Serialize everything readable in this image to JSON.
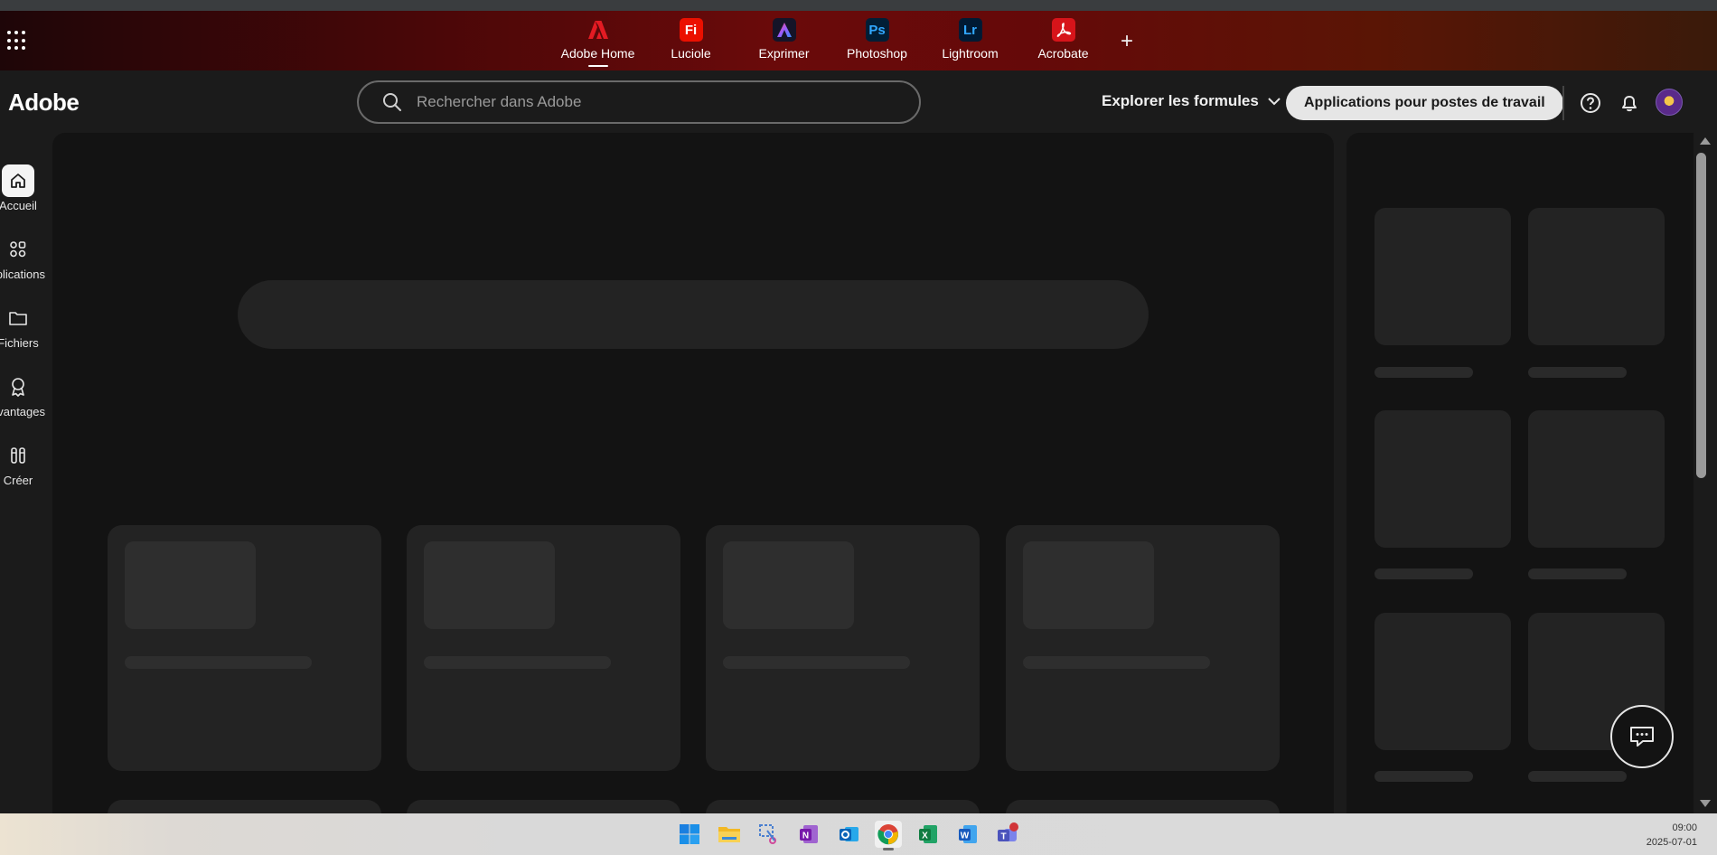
{
  "app_switcher": {
    "apps": [
      {
        "label": "Adobe Home",
        "glyph": "",
        "color": "#e31b23",
        "active": true
      },
      {
        "label": "Luciole",
        "glyph": "Fi",
        "color": "#eb1000"
      },
      {
        "label": "Exprimer",
        "glyph": "",
        "color": "#1a1a3a"
      },
      {
        "label": "Photoshop",
        "glyph": "Ps",
        "color": "#001e36"
      },
      {
        "label": "Lightroom",
        "glyph": "Lr",
        "color": "#001a33"
      },
      {
        "label": "Acrobate",
        "glyph": "",
        "color": "#d7141a"
      }
    ]
  },
  "header": {
    "logo": "Adobe",
    "search_placeholder": "Rechercher dans Adobe",
    "explore_label": "Explorer les formules",
    "desktop_apps_label": "Applications pour postes de travail"
  },
  "left_nav": {
    "items": [
      {
        "label": "Accueil",
        "icon": "home-icon",
        "active": true
      },
      {
        "label": "Applications",
        "icon": "apps-grid-icon"
      },
      {
        "label": "Fichiers",
        "icon": "folder-icon"
      },
      {
        "label": "Avantages",
        "icon": "award-icon"
      },
      {
        "label": "Créer",
        "icon": "create-icon"
      }
    ]
  },
  "taskbar": {
    "icons": [
      "windows-start-icon",
      "file-explorer-icon",
      "snipping-tool-icon",
      "onenote-icon",
      "outlook-icon",
      "chrome-icon",
      "excel-icon",
      "word-icon",
      "teams-icon"
    ],
    "time": "09:00",
    "date": "2025-07-01"
  }
}
